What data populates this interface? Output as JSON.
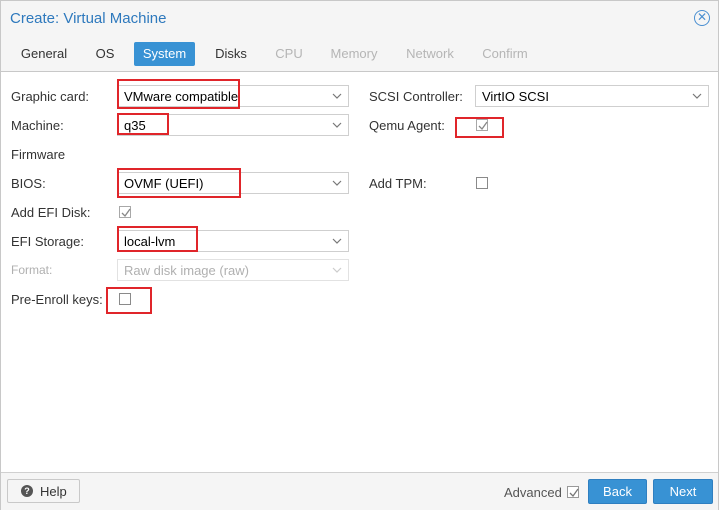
{
  "window": {
    "title": "Create: Virtual Machine"
  },
  "tabs": [
    {
      "label": "General"
    },
    {
      "label": "OS"
    },
    {
      "label": "System"
    },
    {
      "label": "Disks"
    },
    {
      "label": "CPU"
    },
    {
      "label": "Memory"
    },
    {
      "label": "Network"
    },
    {
      "label": "Confirm"
    }
  ],
  "form": {
    "graphic_card": {
      "label": "Graphic card:",
      "value": "VMware compatible"
    },
    "machine": {
      "label": "Machine:",
      "value": "q35"
    },
    "firmware_heading": "Firmware",
    "bios": {
      "label": "BIOS:",
      "value": "OVMF (UEFI)"
    },
    "add_efi_disk": {
      "label": "Add EFI Disk:",
      "checked": true
    },
    "efi_storage": {
      "label": "EFI Storage:",
      "value": "local-lvm"
    },
    "format": {
      "label": "Format:",
      "value": "Raw disk image (raw)"
    },
    "pre_enroll": {
      "label": "Pre-Enroll keys:",
      "checked": false
    },
    "scsi_controller": {
      "label": "SCSI Controller:",
      "value": "VirtIO SCSI"
    },
    "qemu_agent": {
      "label": "Qemu Agent:",
      "checked": true
    },
    "add_tpm": {
      "label": "Add TPM:",
      "checked": false
    }
  },
  "footer": {
    "help_label": "Help",
    "advanced_label": "Advanced",
    "advanced_checked": true,
    "back_label": "Back",
    "next_label": "Next"
  },
  "colors": {
    "accent": "#3892d4",
    "title": "#2e79bd",
    "highlight": "#e0252a"
  }
}
